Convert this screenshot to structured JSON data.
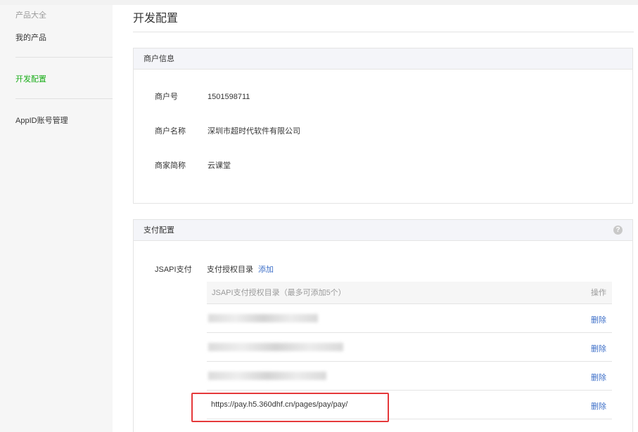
{
  "sidebar": {
    "category": "产品大全",
    "items": [
      {
        "label": "我的产品"
      },
      {
        "label": "开发配置"
      },
      {
        "label": "AppID账号管理"
      }
    ]
  },
  "page": {
    "title": "开发配置"
  },
  "merchant_info": {
    "heading": "商户信息",
    "rows": [
      {
        "label": "商户号",
        "value": "1501598711"
      },
      {
        "label": "商户名称",
        "value": "深圳市超时代软件有限公司"
      },
      {
        "label": "商家简称",
        "value": "云课堂"
      }
    ]
  },
  "payment_config": {
    "heading": "支付配置",
    "help_glyph": "?",
    "jsapi_label": "JSAPI支付",
    "dir_label": "支付授权目录",
    "add_label": "添加",
    "table": {
      "header": "JSAPI支付授权目录（最多可添加5个）",
      "op_header": "操作",
      "rows": [
        {
          "url": "",
          "delete_label": "删除"
        },
        {
          "url": "",
          "delete_label": "删除"
        },
        {
          "url": "",
          "delete_label": "删除"
        },
        {
          "url": "https://pay.h5.360dhf.cn/pages/pay/pay/",
          "delete_label": "删除"
        }
      ]
    }
  },
  "colors": {
    "accent": "#1aad19",
    "link": "#3d6fc8",
    "highlight": "#e5393b"
  }
}
